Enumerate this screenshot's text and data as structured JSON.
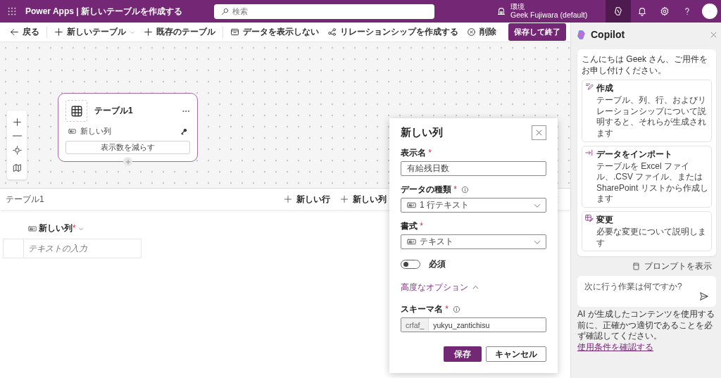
{
  "header": {
    "title": "Power Apps | 新しいテーブルを作成する",
    "search": {
      "placeholder": "検索"
    },
    "environment": {
      "label": "環境",
      "name": "Geek Fujiwara (default)"
    },
    "icons": [
      {
        "kind": "copilot",
        "selected": true
      },
      {
        "kind": "bell",
        "selected": false
      },
      {
        "kind": "settings",
        "selected": false
      },
      {
        "kind": "help",
        "selected": false
      },
      {
        "kind": "avatar",
        "selected": false
      }
    ]
  },
  "toolbar": {
    "groups": [
      [
        {
          "kind": "back",
          "label": "戻る",
          "has_menu": false
        }
      ],
      [
        {
          "kind": "new",
          "label": "新しいテーブル",
          "has_menu": true
        },
        {
          "kind": "add",
          "label": "既存のテーブル",
          "has_menu": false
        }
      ],
      [
        {
          "kind": "hide",
          "label": "データを表示しない",
          "has_menu": false
        },
        {
          "kind": "relation",
          "label": "リレーションシップを作成する",
          "has_menu": false
        },
        {
          "kind": "delete",
          "label": "削除",
          "has_menu": false
        }
      ]
    ],
    "primary_button": "保存して終了"
  },
  "canvas": {
    "table_card": {
      "title": "テーブル1",
      "column": "新しい列",
      "collapse_button": "表示数を減らす"
    }
  },
  "grid": {
    "title": "テーブル1",
    "actions": [
      "新しい行",
      "新しい列"
    ],
    "column": {
      "label": "新しい列",
      "required_mark": "*"
    },
    "cell": {
      "placeholder": "テキストの入力"
    }
  },
  "dialog": {
    "title": "新しい列",
    "fields": [
      {
        "kind": "text",
        "label": "表示名",
        "required_mark": "*",
        "info": false,
        "value": "有給残日数"
      },
      {
        "kind": "select",
        "label": "データの種類",
        "required_mark": "*",
        "info": true,
        "value": "1 行テキスト"
      },
      {
        "kind": "select",
        "label": "書式",
        "required_mark": "*",
        "info": false,
        "value": "テキスト"
      },
      {
        "kind": "toggle",
        "label": "必須",
        "on": false
      },
      {
        "kind": "expander",
        "label": "高度なオプション",
        "expanded": true
      },
      {
        "kind": "prefixed",
        "label": "スキーマ名",
        "required_mark": "*",
        "info": true,
        "prefix": "crfaf_",
        "value": "yukyu_zantichisu"
      }
    ],
    "buttons": [
      {
        "kind": "primary",
        "label": "保存"
      },
      {
        "kind": "secondary",
        "label": "キャンセル"
      }
    ]
  },
  "copilot": {
    "title": "Copilot",
    "greeting": "こんにちは Geek さん、ご用件をお申し付けください。",
    "suggestions": [
      {
        "kind": "create",
        "title": "作成",
        "description": "テーブル、列、行、およびリレーションシップについて説明すると、それらが生成されます"
      },
      {
        "kind": "import",
        "title": "データをインポート",
        "description": "テーブルを Excel ファイル、.CSV ファイル、または SharePoint リストから作成します"
      },
      {
        "kind": "edit",
        "title": "変更",
        "description": "必要な変更について説明します"
      }
    ],
    "show_prompts": "プロンプトを表示",
    "input": {
      "placeholder": "次に行う作業は何ですか?"
    },
    "disclaimer": "AI が生成したコンテンツを使用する前に、正確かつ適切であることを必ず確認してください。",
    "disclaimer_link": "使用条件を確認する"
  }
}
